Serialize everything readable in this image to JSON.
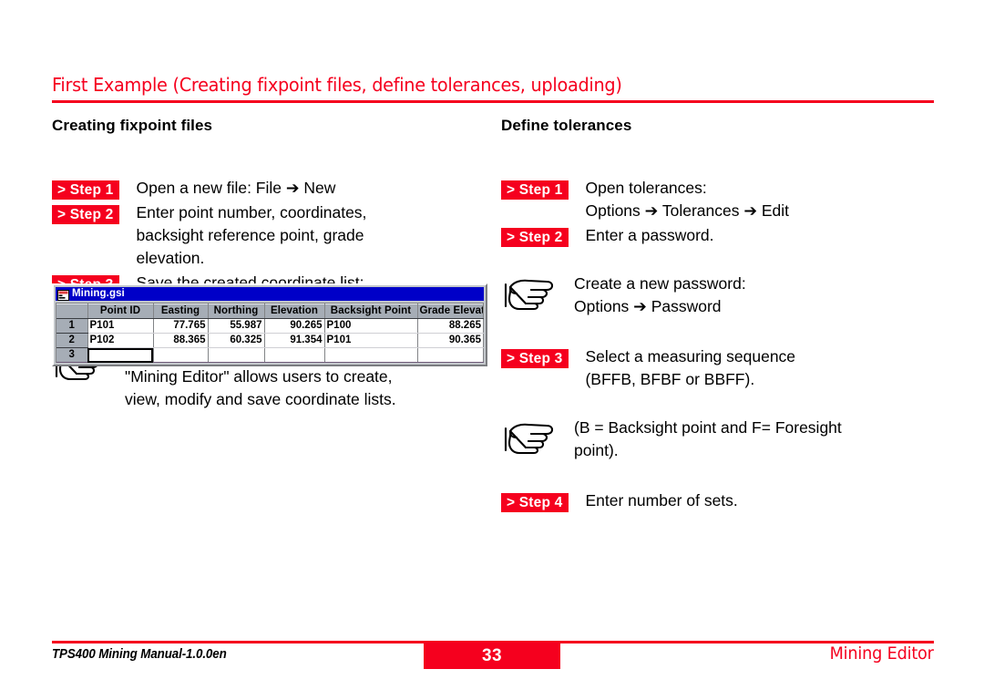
{
  "header": {
    "title": "First Example (Creating fixpoint files, define tolerances, uploading)",
    "accent_color": "#f5001e"
  },
  "left_column": {
    "heading": "Creating fixpoint files",
    "blocks": [
      {
        "kind": "step",
        "badge": "> Step 1",
        "text": "Open a new file: File ➔ New"
      },
      {
        "kind": "step",
        "badge": "> Step 2",
        "text": "Enter point number, coordinates,\nbacksight reference point, grade\nelevation."
      },
      {
        "kind": "step",
        "badge": "> Step 3",
        "text": "Save the created coordinate list:\nFile ➔ Save As"
      },
      {
        "kind": "note",
        "icon": "pointing-hand-icon",
        "text": "In the fixpoint entry module, the\n\"Mining Editor\" allows users to create,\nview, modify and save coordinate lists."
      }
    ]
  },
  "right_column": {
    "heading": "Define tolerances",
    "blocks": [
      {
        "kind": "step",
        "badge": "> Step 1",
        "text": "Open tolerances:\nOptions  ➔ Tolerances  ➔ Edit"
      },
      {
        "kind": "step",
        "badge": "> Step 2",
        "text": "Enter a password."
      },
      {
        "kind": "note",
        "icon": "pointing-hand-icon",
        "text": "Create a new password:\nOptions ➔ Password"
      },
      {
        "kind": "step",
        "badge": "> Step 3",
        "text": "Select a measuring sequence\n(BFFB, BFBF or BBFF)."
      },
      {
        "kind": "note",
        "icon": "pointing-hand-icon",
        "text": "(B = Backsight point and F= Foresight\npoint)."
      },
      {
        "kind": "step",
        "badge": "> Step 4",
        "text": "Enter number of sets."
      }
    ]
  },
  "spreadsheet": {
    "title": "Mining.gsi",
    "title_icon": "spreadsheet-document-icon",
    "columns": [
      "",
      "Point ID",
      "Easting",
      "Northing",
      "Elevation",
      "Backsight Point",
      "Grade Elevation"
    ],
    "rows": [
      {
        "num": "1",
        "cells": [
          "P101",
          "77.765",
          "55.987",
          "90.265",
          "P100",
          "88.265"
        ]
      },
      {
        "num": "2",
        "cells": [
          "P102",
          "88.365",
          "60.325",
          "91.354",
          "P101",
          "90.365"
        ]
      },
      {
        "num": "3",
        "cells": [
          "",
          "",
          "",
          "",
          "",
          ""
        ]
      }
    ],
    "selected_cell": {
      "row": "3",
      "column": "Point ID"
    }
  },
  "footer": {
    "left": "TPS400 Mining Manual-1.0.0en",
    "page_number": "33",
    "right": "Mining Editor"
  }
}
